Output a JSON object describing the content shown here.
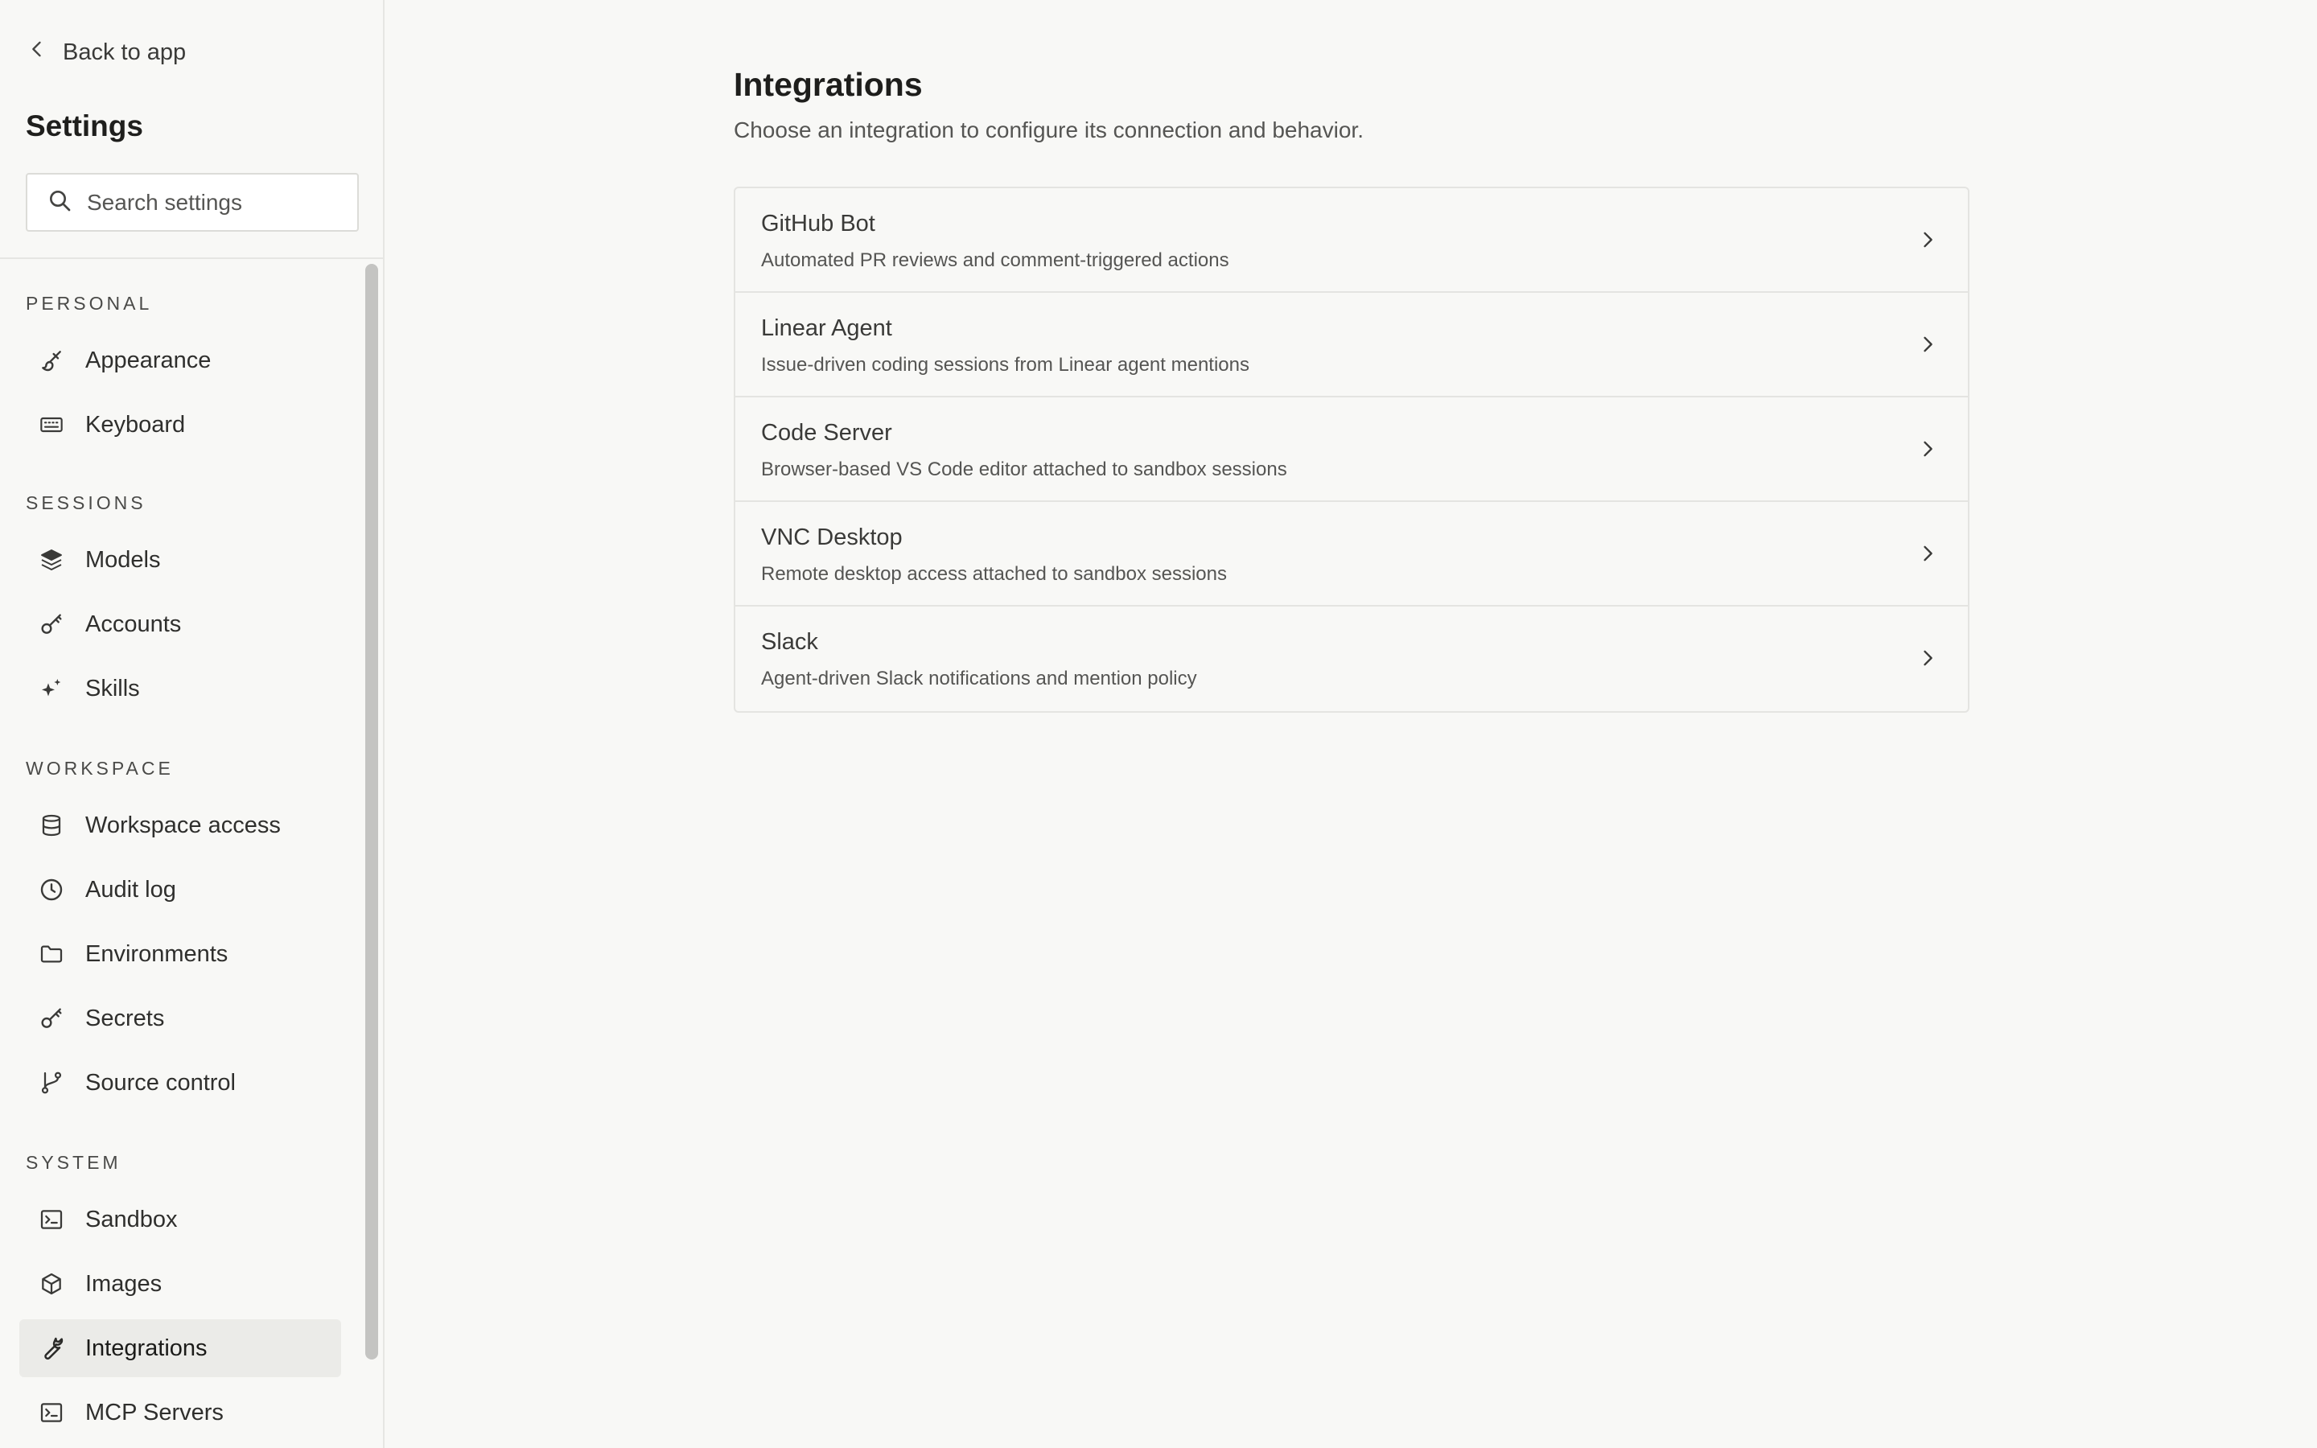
{
  "sidebar": {
    "back_label": "Back to app",
    "title": "Settings",
    "search": {
      "placeholder": "Search settings",
      "value": ""
    },
    "sections": [
      {
        "label": "PERSONAL",
        "items": [
          {
            "label": "Appearance",
            "icon": "brush-icon"
          },
          {
            "label": "Keyboard",
            "icon": "keyboard-icon"
          }
        ]
      },
      {
        "label": "SESSIONS",
        "items": [
          {
            "label": "Models",
            "icon": "layers-icon"
          },
          {
            "label": "Accounts",
            "icon": "key-icon"
          },
          {
            "label": "Skills",
            "icon": "sparkles-icon"
          }
        ]
      },
      {
        "label": "WORKSPACE",
        "items": [
          {
            "label": "Workspace access",
            "icon": "database-icon"
          },
          {
            "label": "Audit log",
            "icon": "clock-icon"
          },
          {
            "label": "Environments",
            "icon": "folder-icon"
          },
          {
            "label": "Secrets",
            "icon": "key-icon"
          },
          {
            "label": "Source control",
            "icon": "git-branch-icon"
          }
        ]
      },
      {
        "label": "SYSTEM",
        "items": [
          {
            "label": "Sandbox",
            "icon": "terminal-icon"
          },
          {
            "label": "Images",
            "icon": "box-icon"
          },
          {
            "label": "Integrations",
            "icon": "wrench-icon",
            "active": true
          },
          {
            "label": "MCP Servers",
            "icon": "terminal-icon"
          }
        ]
      }
    ]
  },
  "main": {
    "title": "Integrations",
    "subtitle": "Choose an integration to configure its connection and behavior.",
    "integrations": [
      {
        "name": "GitHub Bot",
        "description": "Automated PR reviews and comment-triggered actions"
      },
      {
        "name": "Linear Agent",
        "description": "Issue-driven coding sessions from Linear agent mentions"
      },
      {
        "name": "Code Server",
        "description": "Browser-based VS Code editor attached to sandbox sessions"
      },
      {
        "name": "VNC Desktop",
        "description": "Remote desktop access attached to sandbox sessions"
      },
      {
        "name": "Slack",
        "description": "Agent-driven Slack notifications and mention policy"
      }
    ]
  },
  "colors": {
    "background": "#f8f8f6",
    "active_item": "#ebebe8",
    "border": "#e4e4e1",
    "text": "#2a2a28",
    "muted_text": "#555553"
  }
}
